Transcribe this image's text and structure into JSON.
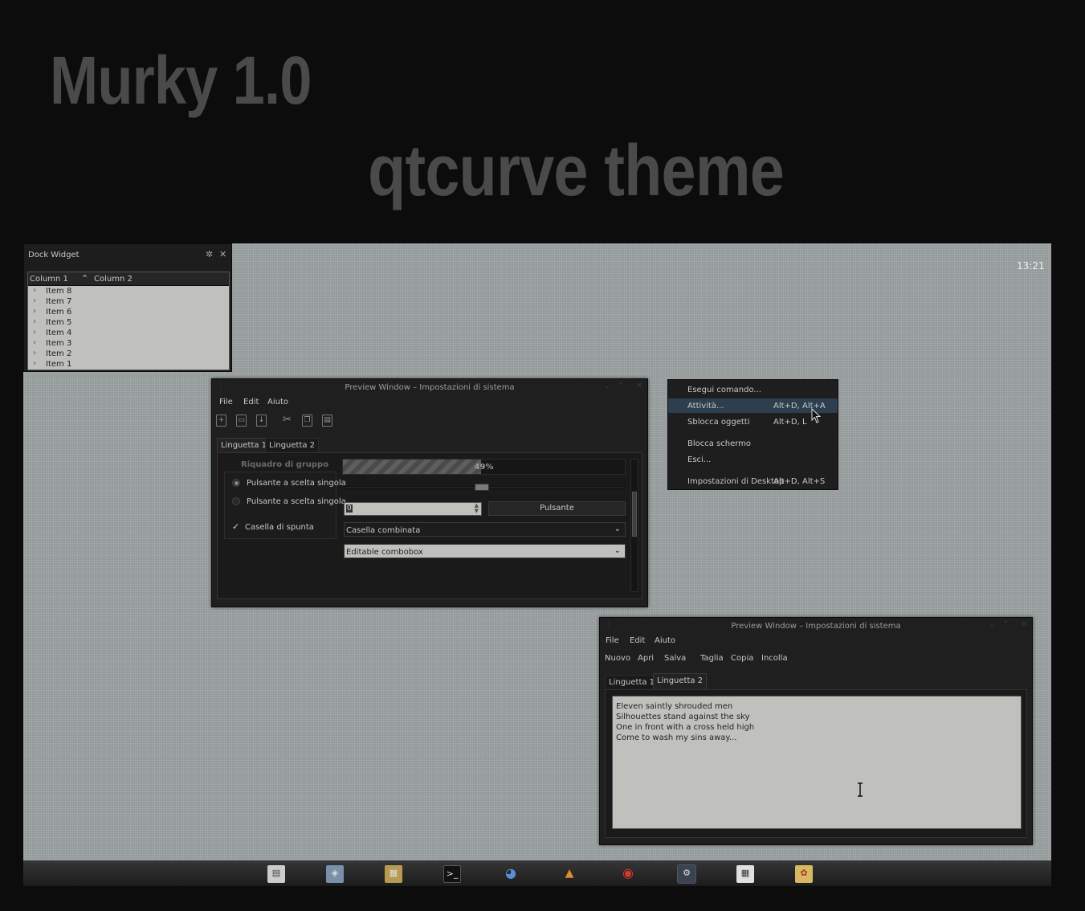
{
  "headline": {
    "title": "Murky 1.0",
    "subtitle": "qtcurve theme"
  },
  "desktop": {
    "clock": "13:21"
  },
  "dock": {
    "title": "Dock Widget",
    "columns": [
      "Column 1",
      "Column 2"
    ],
    "items": [
      "Item 8",
      "Item 7",
      "Item 6",
      "Item 5",
      "Item 4",
      "Item 3",
      "Item 2",
      "Item 1"
    ]
  },
  "window1": {
    "title": "Preview Window – Impostazioni di sistema",
    "menu": [
      "File",
      "Edit",
      "Aiuto"
    ],
    "tabs": [
      "Linguetta 1",
      "Linguetta 2"
    ],
    "group_title": "Riquadro di gruppo",
    "radio1": "Pulsante a scelta singola",
    "radio2": "Pulsante a scelta singola",
    "checkbox": "Casella di spunta",
    "progress_label": "49%",
    "progress_value": 49,
    "spin_value": "0",
    "button": "Pulsante",
    "combo": "Casella combinata",
    "editable_combo": "Editable combobox"
  },
  "context_menu": {
    "items": [
      {
        "label": "Esegui comando...",
        "shortcut": ""
      },
      {
        "label": "Attività...",
        "shortcut": "Alt+D, Alt+A"
      },
      {
        "label": "Sblocca oggetti",
        "shortcut": "Alt+D, L"
      },
      {
        "label": "Blocca schermo",
        "shortcut": ""
      },
      {
        "label": "Esci...",
        "shortcut": ""
      },
      {
        "label": "Impostazioni di Desktop",
        "shortcut": "Alt+D, Alt+S"
      }
    ]
  },
  "window2": {
    "title": "Preview Window – Impostazioni di sistema",
    "menu": [
      "File",
      "Edit",
      "Aiuto"
    ],
    "toolbar": [
      "Nuovo",
      "Apri",
      "Salva",
      "Taglia",
      "Copia",
      "Incolla"
    ],
    "tabs": [
      "Linguetta 1",
      "Linguetta 2"
    ],
    "lines": [
      "Eleven saintly shrouded men",
      "Silhouettes stand against the sky",
      "One in front with a cross held high",
      "Come to wash my sins away..."
    ]
  },
  "taskbar": {
    "apps": [
      "file-manager-icon",
      "image-viewer-icon",
      "notes-icon",
      "terminal-icon",
      "browser-icon",
      "media-player-icon",
      "disc-burner-icon",
      "settings-icon",
      "spreadsheet-icon",
      "paint-icon"
    ]
  },
  "colors": {
    "accent_highlight": "#2d3e4f",
    "desktop_bg": "#9aa0a0",
    "window_bg": "#1f1f1f"
  }
}
